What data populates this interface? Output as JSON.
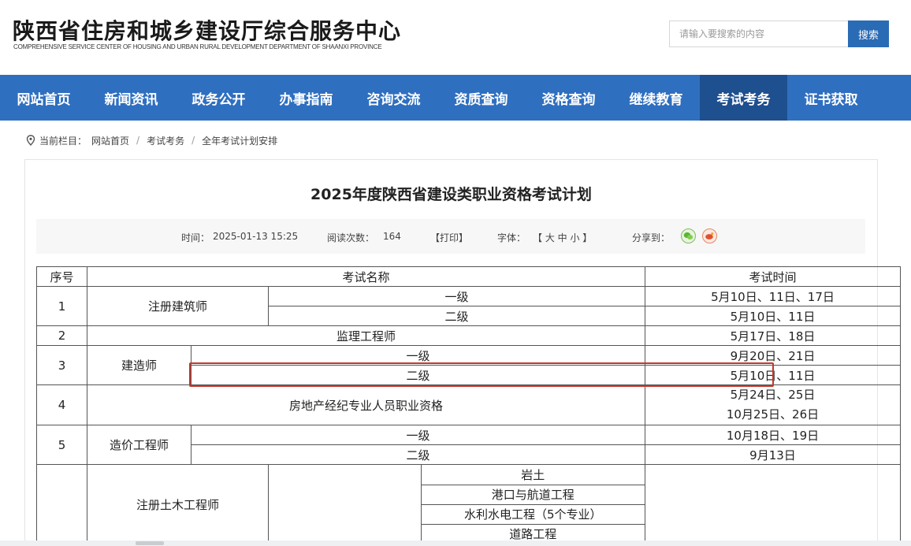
{
  "header": {
    "title": "陕西省住房和城乡建设厅综合服务中心",
    "subtitle": "COMPREHENSIVE SERVICE CENTER OF HOUSING AND URBAN RURAL DEVELOPMENT DEPARTMENT OF SHAANXI PROVINCE",
    "search_placeholder": "请输入要搜索的内容",
    "search_button": "搜索"
  },
  "nav": {
    "items": [
      {
        "label": "网站首页"
      },
      {
        "label": "新闻资讯"
      },
      {
        "label": "政务公开"
      },
      {
        "label": "办事指南"
      },
      {
        "label": "咨询交流"
      },
      {
        "label": "资质查询"
      },
      {
        "label": "资格查询"
      },
      {
        "label": "继续教育"
      },
      {
        "label": "考试考务",
        "active": true
      },
      {
        "label": "证书获取"
      }
    ]
  },
  "breadcrumb": {
    "prefix": "当前栏目：",
    "items": [
      "网站首页",
      "考试考务",
      "全年考试计划安排"
    ],
    "separator": "/"
  },
  "article": {
    "title": "2025年度陕西省建设类职业资格考试计划",
    "meta": {
      "time_label": "时间：",
      "time": "2025-01-13 15:25",
      "views_label": "阅读次数：",
      "views": "164",
      "print": "【打印】",
      "font_label": "字体：",
      "font_sizes": "【 大  中  小 】",
      "share_label": "分享到："
    }
  },
  "table": {
    "headers": {
      "no": "序号",
      "name": "考试名称",
      "time": "考试时间"
    },
    "rows": {
      "r1_no": "1",
      "r1_name": "注册建筑师",
      "r1a_level": "一级",
      "r1a_time": "5月10日、11日、17日",
      "r1b_level": "二级",
      "r1b_time": "5月10日、11日",
      "r2_no": "2",
      "r2_name": "监理工程师",
      "r2_time": "5月17日、18日",
      "r3_no": "3",
      "r3_name": "建造师",
      "r3a_level": "一级",
      "r3a_time": "9月20日、21日",
      "r3b_level": "二级",
      "r3b_time": "5月10日、11日",
      "r4_no": "4",
      "r4_name": "房地产经纪专业人员职业资格",
      "r4_time1": "5月24日、25日",
      "r4_time2": "10月25日、26日",
      "r5_no": "5",
      "r5_name": "造价工程师",
      "r5a_level": "一级",
      "r5a_time": "10月18日、19日",
      "r5b_level": "二级",
      "r5b_time": "9月13日",
      "r6_name": "注册土木工程师",
      "r6_spec1": "岩土",
      "r6_spec2": "港口与航道工程",
      "r6_spec3": "水利水电工程（5个专业）",
      "r6_spec4": "道路工程"
    }
  },
  "colors": {
    "nav_bg": "#2f6fc0",
    "nav_active": "#1e4f8f",
    "search_button": "#2a6bb5",
    "highlight_border": "#c0392b"
  }
}
